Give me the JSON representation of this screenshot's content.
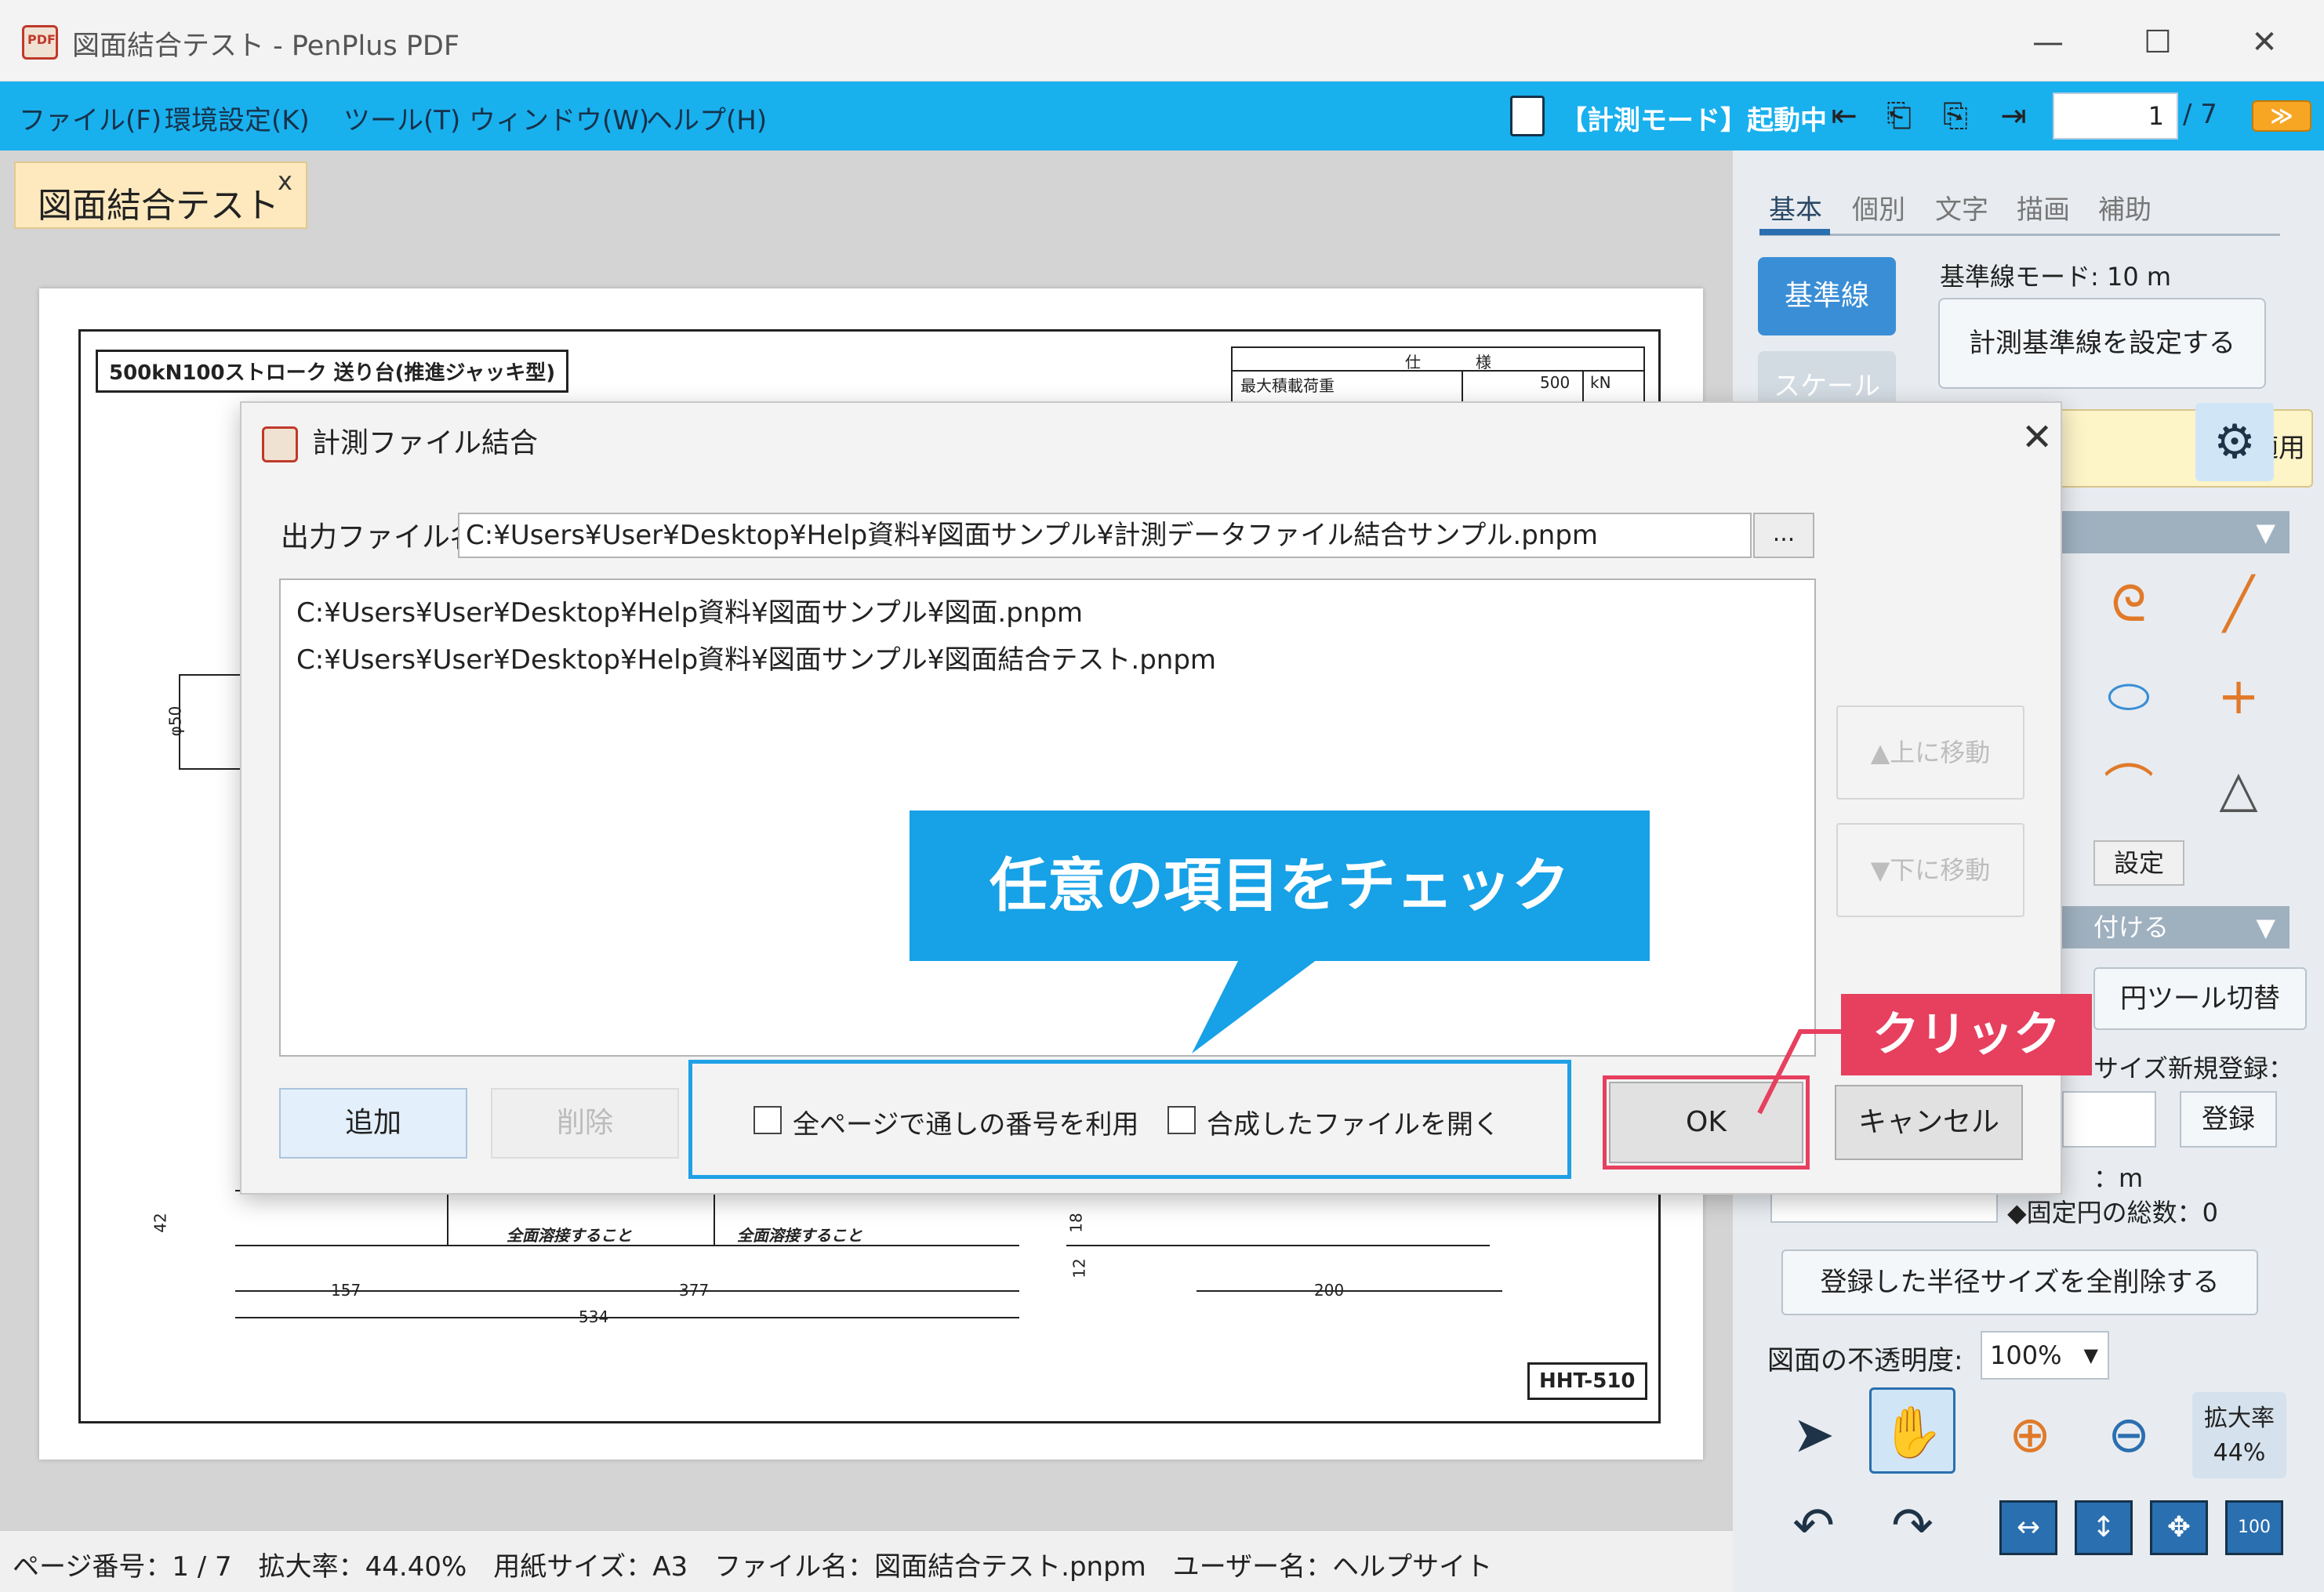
{
  "window": {
    "title": "図面結合テスト - PenPlus PDF",
    "logo_text": "PDF",
    "minimize": "—",
    "maximize": "☐",
    "close": "✕"
  },
  "menu": {
    "items": [
      "ファイル(F)",
      "環境設定(K)",
      "ツール(T)",
      "ウィンドウ(W)",
      "ヘルプ(H)"
    ],
    "mode_status": "【計測モード】起動中",
    "page_current": "1",
    "page_total": "/ 7",
    "collapse_label": "≫",
    "nav_icons": [
      "first-page-icon",
      "prev-page-icon",
      "next-page-icon",
      "last-page-icon"
    ]
  },
  "tab": {
    "label": "図面結合テスト",
    "close": "x"
  },
  "drawing": {
    "title": "500kN100ストローク 送り台(推進ジャッキ型)",
    "spec_header_left": "仕",
    "spec_header_right": "様",
    "spec_row_label": "最大積載荷重",
    "spec_row_value": "500",
    "spec_row_unit": "kN",
    "id": "HHT-510",
    "dims": {
      "d50": "φ50",
      "d42": "42",
      "d18": "18",
      "d12": "12",
      "d157": "157",
      "d377": "377",
      "d534": "534",
      "d200": "200",
      "note1": "全面溶接すること",
      "note2": "全面溶接すること"
    }
  },
  "right_panel": {
    "tabs": [
      "基本",
      "個別",
      "文字",
      "描画",
      "補助"
    ],
    "baseline_btn": "基準線",
    "baseline_mode": "基準線モード: 10 m",
    "set_baseline_btn": "計測基準線を設定する",
    "scale_btn": "スケール",
    "apply_btn": "適用",
    "section1": "",
    "settings_btn": "設定",
    "section2": "付ける",
    "circle_tool_btn": "円ツール切替",
    "radius_register_label": "サイズ新規登録：",
    "register_btn": "登録",
    "radius_unit": "：m",
    "fixed_total": "◆固定円の総数：0",
    "delete_all_btn": "登録した半径サイズを全削除する",
    "opacity_label": "図面の不透明度:",
    "opacity_value": "100%",
    "zoom_label": "拡大率",
    "zoom_value": "44%",
    "fit_100": "100"
  },
  "status_bar": {
    "text": "ページ番号：1 / 7　拡大率：44.40%　用紙サイズ：A3　ファイル名：図面結合テスト.pnpm　ユーザー名：ヘルプサイト"
  },
  "dialog": {
    "title": "計測ファイル結合",
    "close": "✕",
    "output_label": "出力ファイル名:",
    "output_value": "C:¥Users¥User¥Desktop¥Help資料¥図面サンプル¥計測データファイル結合サンプル.pnpm",
    "browse": "...",
    "files": [
      "C:¥Users¥User¥Desktop¥Help資料¥図面サンプル¥図面.pnpm",
      "C:¥Users¥User¥Desktop¥Help資料¥図面サンプル¥図面結合テスト.pnpm"
    ],
    "move_up": "▲上に移動",
    "move_down": "▼下に移動",
    "add": "追加",
    "delete": "削除",
    "option_sequential": "全ページで通しの番号を利用",
    "option_open": "合成したファイルを開く",
    "option_sequential_checked": false,
    "option_open_checked": false,
    "ok": "OK",
    "cancel": "キャンセル"
  },
  "callouts": {
    "check": "任意の項目をチェック",
    "click": "クリック"
  },
  "colors": {
    "menubar": "#19b0ee",
    "callout_blue": "#17a1e6",
    "callout_red": "#e73f5e",
    "tab_bg": "#fde9bd"
  }
}
